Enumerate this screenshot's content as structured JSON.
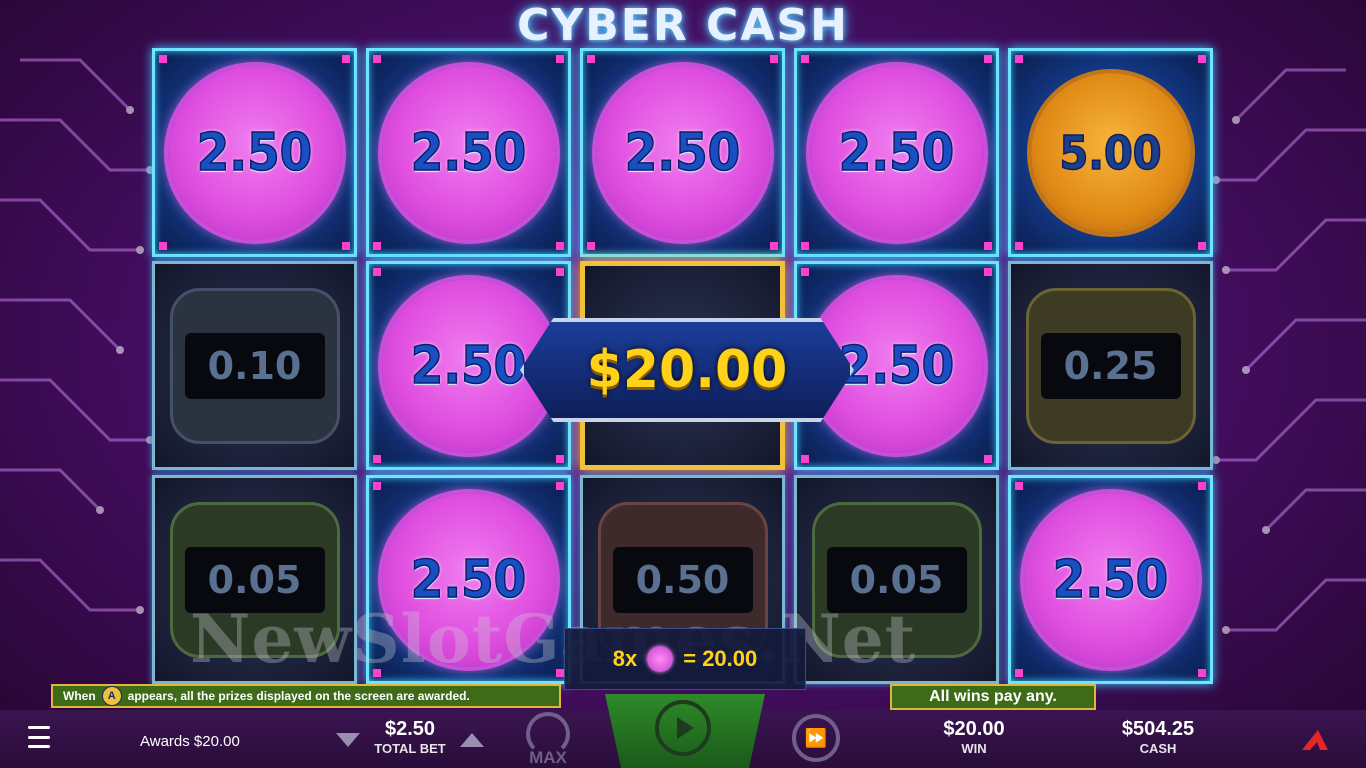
{
  "game": {
    "title": "CYBER CASH"
  },
  "grid": {
    "cells": [
      {
        "type": "coin-pink",
        "value": "2.50"
      },
      {
        "type": "coin-pink",
        "value": "2.50"
      },
      {
        "type": "coin-pink",
        "value": "2.50"
      },
      {
        "type": "coin-pink",
        "value": "2.50"
      },
      {
        "type": "coin-orange",
        "value": "5.00"
      },
      {
        "type": "chip-grey",
        "value": "0.10"
      },
      {
        "type": "coin-pink",
        "value": "2.50"
      },
      {
        "type": "hidden",
        "value": ""
      },
      {
        "type": "coin-pink",
        "value": "2.50"
      },
      {
        "type": "chip-olive",
        "value": "0.25"
      },
      {
        "type": "chip-green",
        "value": "0.05"
      },
      {
        "type": "coin-pink",
        "value": "2.50"
      },
      {
        "type": "chip-brown",
        "value": "0.50"
      },
      {
        "type": "chip-green",
        "value": "0.05"
      },
      {
        "type": "coin-pink",
        "value": "2.50"
      }
    ]
  },
  "win_banner": {
    "amount": "$20.00"
  },
  "formula": {
    "count": "8x",
    "result": "= 20.00"
  },
  "watermark": {
    "text": "NewSlotGames.Net"
  },
  "info": {
    "left_prefix": "When",
    "left_icon": "A",
    "left_suffix": "appears, all the prizes displayed on the screen are awarded.",
    "right": "All wins pay any."
  },
  "bottom": {
    "awards": "Awards $20.00",
    "total_bet_value": "$2.50",
    "total_bet_label": "TOTAL BET",
    "max_label": "MAX",
    "win_value": "$20.00",
    "win_label": "WIN",
    "cash_value": "$504.25",
    "cash_label": "CASH"
  },
  "colors": {
    "accent_cyan": "#6fe3ff",
    "coin_pink": "#e04fe0",
    "gold": "#ffd21a",
    "info_green": "#3e6b18"
  }
}
